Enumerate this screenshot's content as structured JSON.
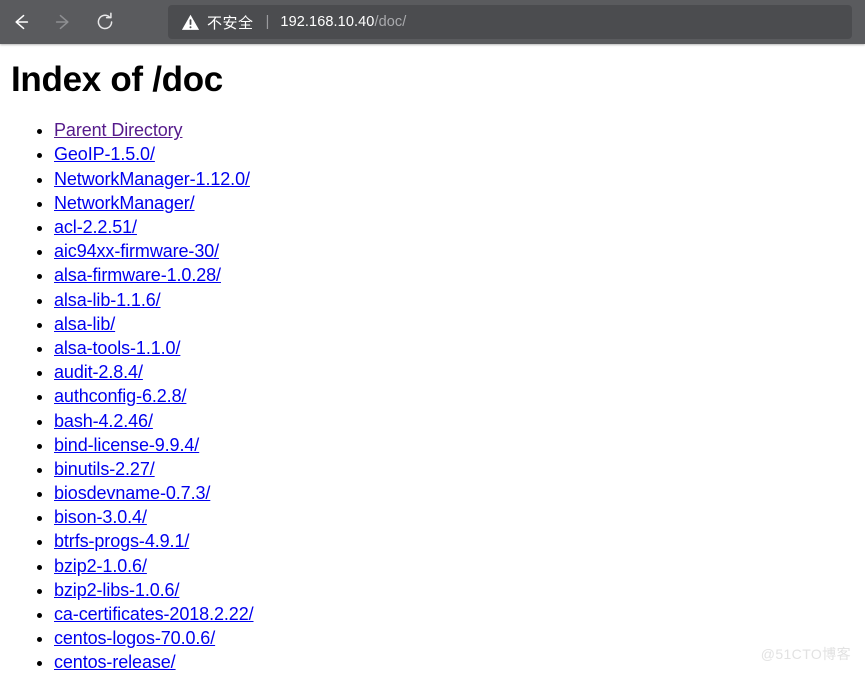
{
  "browser": {
    "toolbar": {
      "back_icon": "arrow-left-icon",
      "forward_icon": "arrow-right-icon",
      "reload_icon": "reload-icon"
    },
    "address_bar": {
      "warning_icon": "warning-triangle-icon",
      "security_label": "不安全",
      "separator": "|",
      "url_host": "192.168.10.40",
      "url_path": "/doc/",
      "full_url": "192.168.10.40/doc/"
    }
  },
  "page": {
    "title": "Index of /doc",
    "links": [
      {
        "label": "Parent Directory",
        "visited": true
      },
      {
        "label": "GeoIP-1.5.0/",
        "visited": false
      },
      {
        "label": "NetworkManager-1.12.0/",
        "visited": false
      },
      {
        "label": "NetworkManager/",
        "visited": false
      },
      {
        "label": "acl-2.2.51/",
        "visited": false
      },
      {
        "label": "aic94xx-firmware-30/",
        "visited": false
      },
      {
        "label": "alsa-firmware-1.0.28/",
        "visited": false
      },
      {
        "label": "alsa-lib-1.1.6/",
        "visited": false
      },
      {
        "label": "alsa-lib/",
        "visited": false
      },
      {
        "label": "alsa-tools-1.1.0/",
        "visited": false
      },
      {
        "label": "audit-2.8.4/",
        "visited": false
      },
      {
        "label": "authconfig-6.2.8/",
        "visited": false
      },
      {
        "label": "bash-4.2.46/",
        "visited": false
      },
      {
        "label": "bind-license-9.9.4/",
        "visited": false
      },
      {
        "label": "binutils-2.27/",
        "visited": false
      },
      {
        "label": "biosdevname-0.7.3/",
        "visited": false
      },
      {
        "label": "bison-3.0.4/",
        "visited": false
      },
      {
        "label": "btrfs-progs-4.9.1/",
        "visited": false
      },
      {
        "label": "bzip2-1.0.6/",
        "visited": false
      },
      {
        "label": "bzip2-libs-1.0.6/",
        "visited": false
      },
      {
        "label": "ca-certificates-2018.2.22/",
        "visited": false
      },
      {
        "label": "centos-logos-70.0.6/",
        "visited": false
      },
      {
        "label": "centos-release/",
        "visited": false
      }
    ]
  },
  "watermark": {
    "text": "@51CTO博客"
  },
  "colors": {
    "toolbar_bg": "#5a5b5e",
    "address_bar_bg": "#4b4c4f",
    "link": "#0000ee",
    "link_visited": "#551a8b",
    "page_bg": "#ffffff"
  }
}
